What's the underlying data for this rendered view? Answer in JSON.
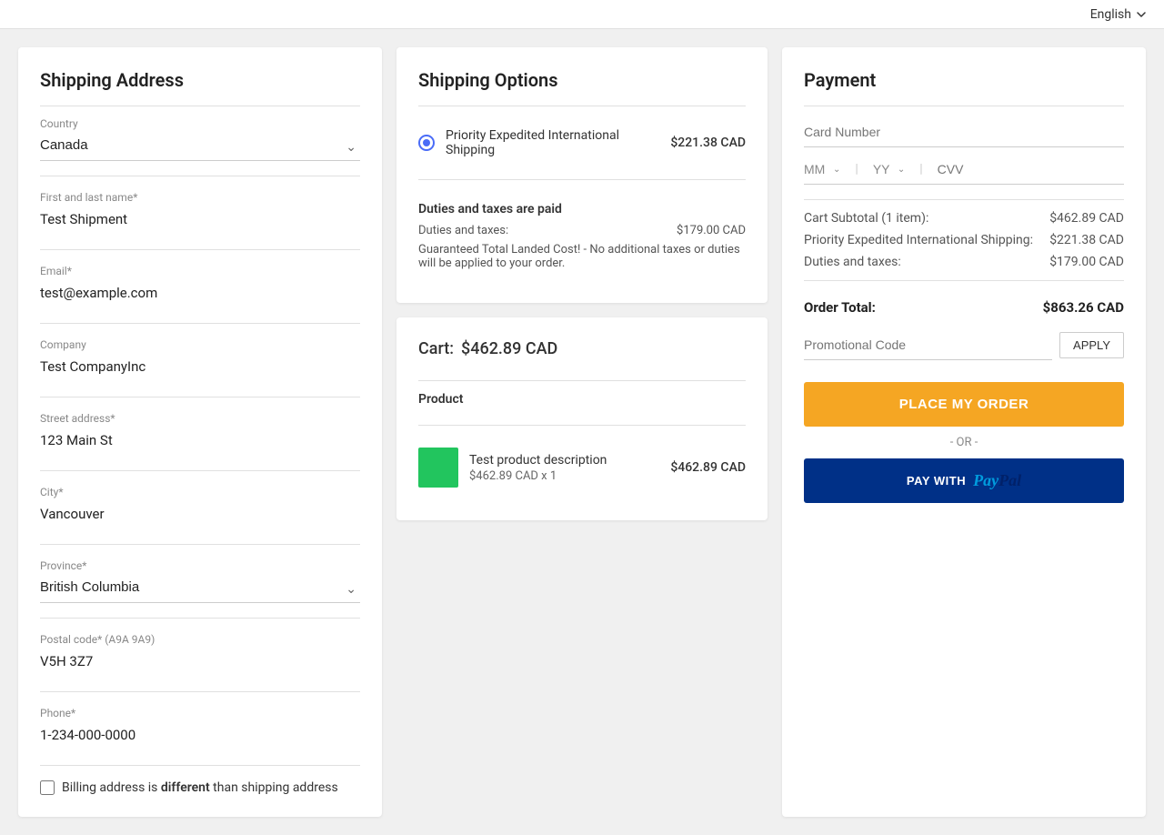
{
  "topbar": {
    "language_label": "English"
  },
  "shipping_address": {
    "title": "Shipping Address",
    "country_label": "Country",
    "country_value": "Canada",
    "name_label": "First and last name*",
    "name_value": "Test Shipment",
    "email_label": "Email*",
    "email_value": "test@example.com",
    "company_label": "Company",
    "company_value": "Test CompanyInc",
    "street_label": "Street address*",
    "street_value": "123 Main St",
    "city_label": "City*",
    "city_value": "Vancouver",
    "province_label": "Province*",
    "province_value": "British Columbia",
    "postal_label": "Postal code* (A9A 9A9)",
    "postal_value": "V5H 3Z7",
    "phone_label": "Phone*",
    "phone_value": "1-234-000-0000",
    "billing_checkbox_label": "Billing address is ",
    "billing_different": "different",
    "billing_suffix": " than shipping address"
  },
  "shipping_options": {
    "title": "Shipping Options",
    "option_label": "Priority Expedited International Shipping",
    "option_price": "$221.38 CAD",
    "duties_title": "Duties and taxes are paid",
    "duties_label": "Duties and taxes:",
    "duties_value": "$179.00 CAD",
    "duties_note": "Guaranteed Total Landed Cost! - No additional taxes or duties will be applied to your order."
  },
  "cart": {
    "title": "Cart:",
    "cart_total": "$462.89 CAD",
    "product_header": "Product",
    "product_name": "Test product description",
    "product_price": "$462.89 CAD",
    "product_sub": "$462.89 CAD x 1"
  },
  "payment": {
    "title": "Payment",
    "card_number_placeholder": "Card Number",
    "mm_label": "MM",
    "yy_label": "YY",
    "cvv_placeholder": "CVV",
    "subtotal_label": "Cart Subtotal (1 item):",
    "subtotal_value": "$462.89 CAD",
    "shipping_label": "Priority Expedited International Shipping:",
    "shipping_value": "$221.38 CAD",
    "duties_label": "Duties and taxes:",
    "duties_value": "$179.00 CAD",
    "order_total_label": "Order Total:",
    "order_total_value": "$863.26 CAD",
    "promo_placeholder": "Promotional Code",
    "apply_label": "APPLY",
    "place_order_label": "PLACE MY ORDER",
    "or_label": "- OR -",
    "paypal_label": "PAY WITH",
    "paypal_brand": "PayPal"
  }
}
